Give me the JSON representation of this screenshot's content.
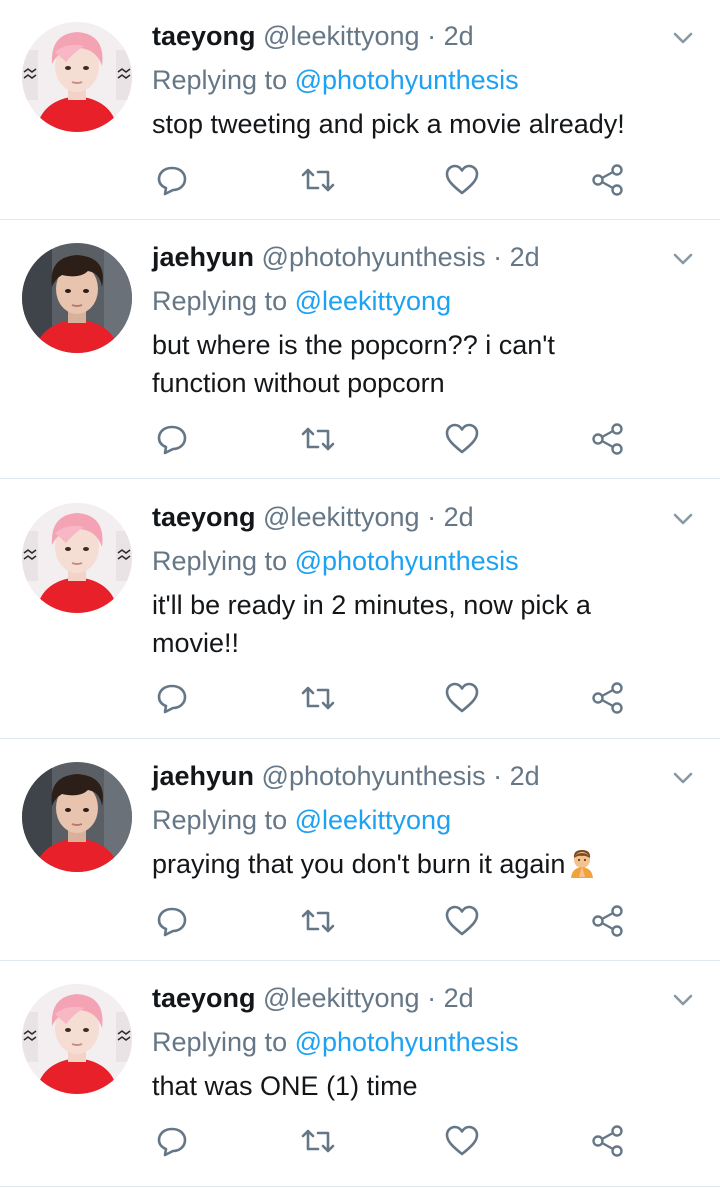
{
  "tweets": [
    {
      "author_name": "taeyong",
      "author_handle": "@leekittyong",
      "time": "2d",
      "replying_prefix": "Replying to ",
      "replying_to": "@photohyunthesis",
      "text": "stop tweeting and pick a movie already!",
      "avatar": "pink-hair-avatar",
      "emoji": ""
    },
    {
      "author_name": "jaehyun",
      "author_handle": "@photohyunthesis",
      "time": "2d",
      "replying_prefix": "Replying to ",
      "replying_to": "@leekittyong",
      "text": "but where is the popcorn?? i can't function without popcorn",
      "avatar": "dark-hair-avatar",
      "emoji": ""
    },
    {
      "author_name": "taeyong",
      "author_handle": "@leekittyong",
      "time": "2d",
      "replying_prefix": "Replying to ",
      "replying_to": "@photohyunthesis",
      "text": "it'll be ready in 2 minutes, now pick a movie!!",
      "avatar": "pink-hair-avatar",
      "emoji": ""
    },
    {
      "author_name": "jaehyun",
      "author_handle": "@photohyunthesis",
      "time": "2d",
      "replying_prefix": "Replying to ",
      "replying_to": "@leekittyong",
      "text": "praying that you don't burn it again",
      "avatar": "dark-hair-avatar",
      "emoji": "person-praying-emoji"
    },
    {
      "author_name": "taeyong",
      "author_handle": "@leekittyong",
      "time": "2d",
      "replying_prefix": "Replying to ",
      "replying_to": "@photohyunthesis",
      "text": "that was ONE (1) time",
      "avatar": "pink-hair-avatar",
      "emoji": ""
    }
  ],
  "separator": "·",
  "icons": {
    "reply": "reply-icon",
    "retweet": "retweet-icon",
    "like": "heart-icon",
    "share": "share-icon",
    "more": "chevron-down-icon"
  },
  "colors": {
    "link": "#1da1f2",
    "secondary_text": "#657786",
    "primary_text": "#14171a",
    "divider": "#e1e8ed",
    "avatar_shirt": "#e8202a",
    "pink_hair": "#f4a3b4",
    "dark_hair": "#2b1f18"
  }
}
